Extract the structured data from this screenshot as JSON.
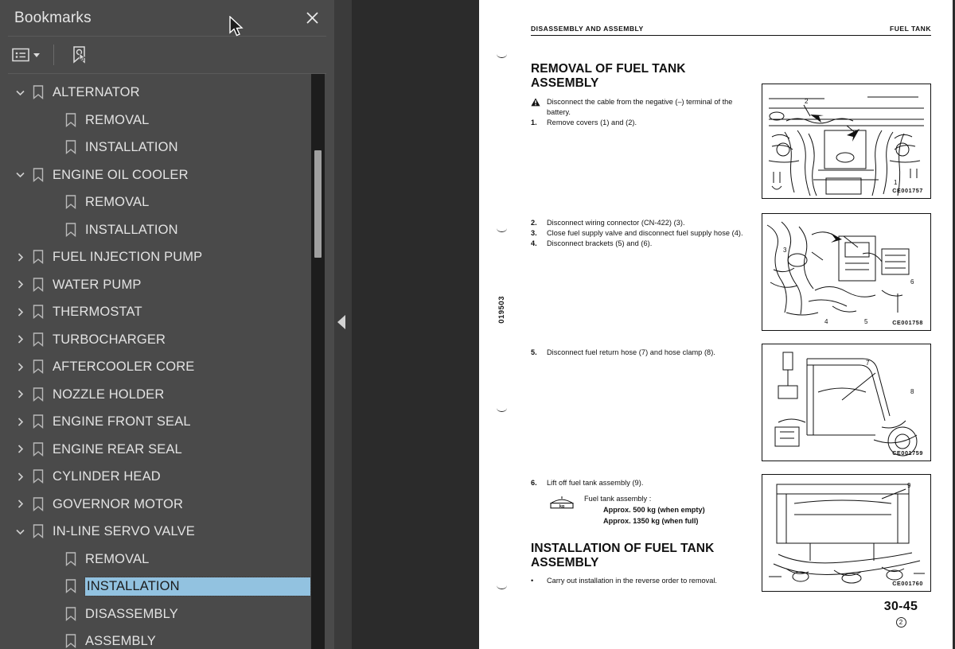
{
  "panel": {
    "title": "Bookmarks",
    "close_icon": "close-icon",
    "toolbar": {
      "list_options_icon": "list-view-icon",
      "dropdown_icon": "chevron-down-icon",
      "find_bookmark_icon": "bookmark-pointer-icon"
    },
    "colors": {
      "panel_bg": "#4a4a4a",
      "viewer_bg": "#2b2b2b",
      "selection": "#92c2e0",
      "text": "#e3e3e3"
    },
    "items": [
      {
        "label": "ALTERNATOR",
        "level": 0,
        "state": "expanded",
        "selected": false
      },
      {
        "label": "REMOVAL",
        "level": 1,
        "state": "leaf",
        "selected": false
      },
      {
        "label": "INSTALLATION",
        "level": 1,
        "state": "leaf",
        "selected": false
      },
      {
        "label": "ENGINE OIL COOLER",
        "level": 0,
        "state": "expanded",
        "selected": false
      },
      {
        "label": "REMOVAL",
        "level": 1,
        "state": "leaf",
        "selected": false
      },
      {
        "label": "INSTALLATION",
        "level": 1,
        "state": "leaf",
        "selected": false
      },
      {
        "label": "FUEL INJECTION PUMP",
        "level": 0,
        "state": "collapsed",
        "selected": false
      },
      {
        "label": "WATER PUMP",
        "level": 0,
        "state": "collapsed",
        "selected": false
      },
      {
        "label": "THERMOSTAT",
        "level": 0,
        "state": "collapsed",
        "selected": false
      },
      {
        "label": "TURBOCHARGER",
        "level": 0,
        "state": "collapsed",
        "selected": false
      },
      {
        "label": "AFTERCOOLER CORE",
        "level": 0,
        "state": "collapsed",
        "selected": false
      },
      {
        "label": "NOZZLE HOLDER",
        "level": 0,
        "state": "collapsed",
        "selected": false
      },
      {
        "label": "ENGINE FRONT SEAL",
        "level": 0,
        "state": "collapsed",
        "selected": false
      },
      {
        "label": "ENGINE REAR SEAL",
        "level": 0,
        "state": "collapsed",
        "selected": false
      },
      {
        "label": "CYLINDER HEAD",
        "level": 0,
        "state": "collapsed",
        "selected": false
      },
      {
        "label": "GOVERNOR MOTOR",
        "level": 0,
        "state": "collapsed",
        "selected": false
      },
      {
        "label": "IN-LINE SERVO VALVE",
        "level": 0,
        "state": "expanded",
        "selected": false
      },
      {
        "label": "REMOVAL",
        "level": 1,
        "state": "leaf",
        "selected": false
      },
      {
        "label": "INSTALLATION",
        "level": 1,
        "state": "leaf",
        "selected": true
      },
      {
        "label": "DISASSEMBLY",
        "level": 1,
        "state": "leaf",
        "selected": false
      },
      {
        "label": "ASSEMBLY",
        "level": 1,
        "state": "leaf",
        "selected": false
      }
    ]
  },
  "divider": {
    "collapse_icon": "collapse-left-icon"
  },
  "page": {
    "header_left": "DISASSEMBLY AND ASSEMBLY",
    "header_right": "FUEL TANK",
    "side_code": "019503",
    "section1_title": "REMOVAL OF FUEL TANK ASSEMBLY",
    "warning": {
      "icon": "warning-triangle-icon",
      "text": "Disconnect the cable from the negative (–) terminal of the battery."
    },
    "steps": [
      {
        "num": "1.",
        "text": "Remove covers (1) and (2)."
      },
      {
        "num": "2.",
        "text": "Disconnect wiring connector (CN-422) (3)."
      },
      {
        "num": "3.",
        "text": "Close fuel supply valve and disconnect fuel supply hose (4)."
      },
      {
        "num": "4.",
        "text": "Disconnect brackets (5) and (6)."
      },
      {
        "num": "5.",
        "text": "Disconnect fuel return hose (7) and hose clamp (8)."
      },
      {
        "num": "6.",
        "text": "Lift off fuel tank assembly (9)."
      }
    ],
    "weight_spec": {
      "icon": "lifting-weight-kg-icon",
      "icon_label": "kg",
      "label": "Fuel tank assembly :",
      "line1": "Approx. 500 kg (when empty)",
      "line2": "Approx. 1350 kg (when full)"
    },
    "section2_title": "INSTALLATION OF FUEL TANK ASSEMBLY",
    "section2_bullet": {
      "marker": "•",
      "text": "Carry out installation in the reverse order to removal."
    },
    "figures": [
      {
        "caption": "CE001757"
      },
      {
        "caption": "CE001758"
      },
      {
        "caption": "CE001759"
      },
      {
        "caption": "CE001760"
      }
    ],
    "page_number": "30-45",
    "page_revision": "2"
  },
  "cursor": {
    "icon": "mouse-pointer-icon"
  }
}
